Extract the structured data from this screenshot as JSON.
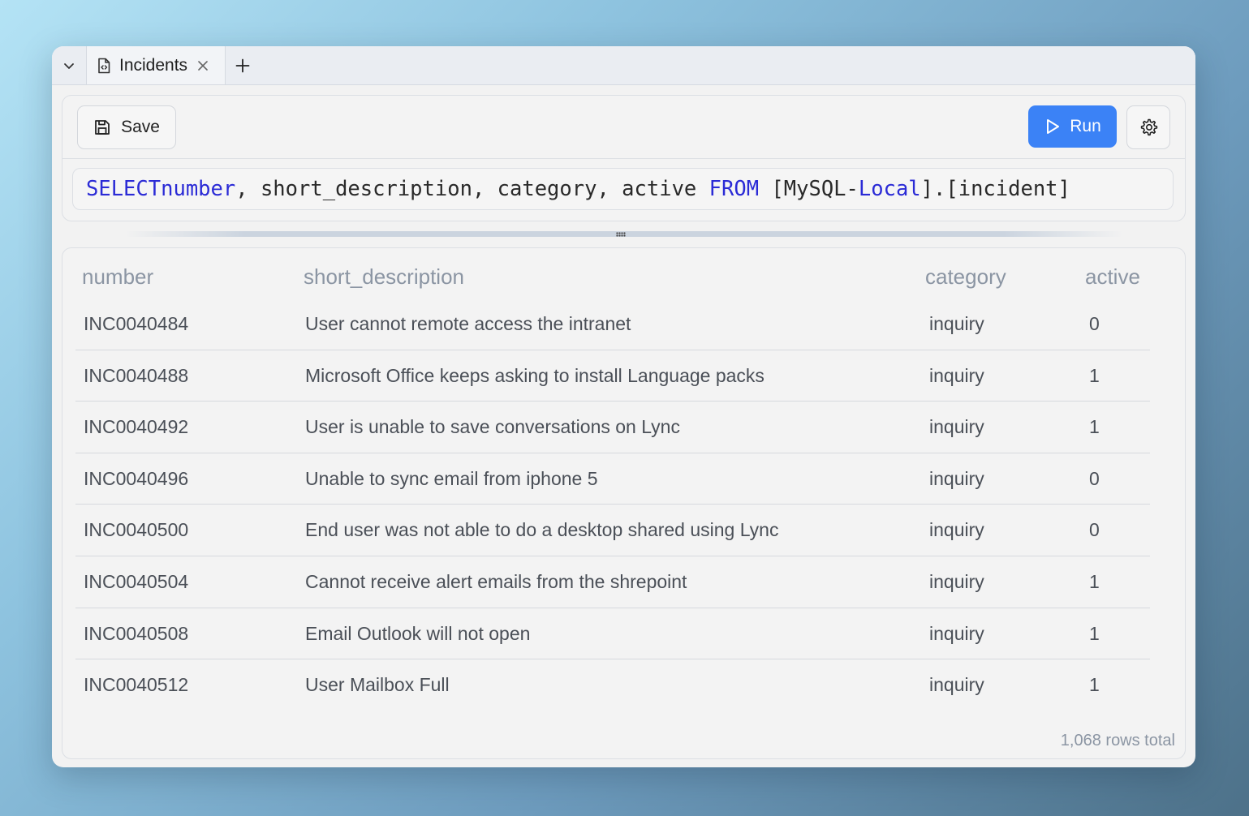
{
  "tabs": {
    "active_label": "Incidents"
  },
  "toolbar": {
    "save_label": "Save",
    "run_label": "Run"
  },
  "query": {
    "select_kw": "SELECT",
    "field_number": "number",
    "mid_text": ", short_description, category, active ",
    "from_kw": "FROM",
    "source_open": " [MySQL-",
    "source_local": "Local",
    "source_close": "].[incident]"
  },
  "results": {
    "columns": [
      "number",
      "short_description",
      "category",
      "active"
    ],
    "rows": [
      {
        "number": "INC0040484",
        "short_description": "User cannot remote access the intranet",
        "category": "inquiry",
        "active": "0"
      },
      {
        "number": "INC0040488",
        "short_description": "Microsoft Office keeps asking to install Language packs",
        "category": "inquiry",
        "active": "1"
      },
      {
        "number": "INC0040492",
        "short_description": "User is unable to save conversations on Lync",
        "category": "inquiry",
        "active": "1"
      },
      {
        "number": "INC0040496",
        "short_description": "Unable to sync email from iphone 5",
        "category": "inquiry",
        "active": "0"
      },
      {
        "number": "INC0040500",
        "short_description": "End user was not able to do a desktop shared using Lync",
        "category": "inquiry",
        "active": "0"
      },
      {
        "number": "INC0040504",
        "short_description": "Cannot receive alert emails from the shrepoint",
        "category": "inquiry",
        "active": "1"
      },
      {
        "number": "INC0040508",
        "short_description": "Email Outlook will not open",
        "category": "inquiry",
        "active": "1"
      },
      {
        "number": "INC0040512",
        "short_description": "User Mailbox Full",
        "category": "inquiry",
        "active": "1"
      }
    ],
    "footer": "1,068 rows total"
  },
  "colors": {
    "accent": "#3b82f6",
    "keyword": "#2b2bd6",
    "muted_text": "#8b95a3"
  },
  "icons": [
    "chevron-down-icon",
    "file-code-icon",
    "close-icon",
    "plus-icon",
    "save-icon",
    "play-icon",
    "gear-icon",
    "drag-handle-icon"
  ]
}
